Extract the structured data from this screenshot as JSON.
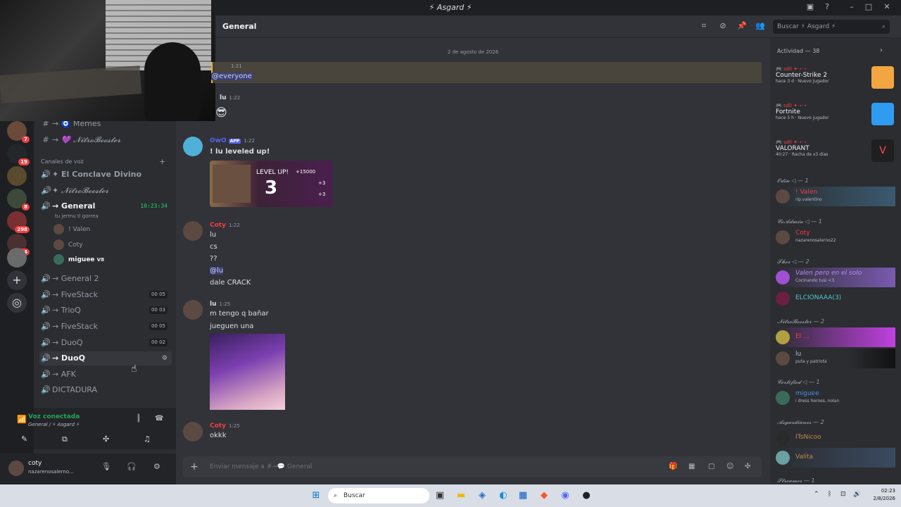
{
  "window": {
    "title": "⚡ Asgard ⚡"
  },
  "servers": [
    {
      "badge": "7"
    },
    {
      "badge": "19"
    },
    {
      "badge": ""
    },
    {
      "badge": "8"
    },
    {
      "badge": ""
    },
    {
      "badge": "298"
    },
    {
      "badge": "214"
    },
    {
      "badge": ""
    }
  ],
  "sidebar": {
    "text_channels": [
      {
        "label": "→ 🧿 Memes"
      },
      {
        "label": "→ 💜 𝓝𝓲𝓽𝓻𝓸𝓑𝓸𝓸𝓼𝓽𝓮𝓻"
      }
    ],
    "voice_category": "Canales de voz",
    "voice_channels": [
      {
        "label": "✦ El Conclave Divino",
        "count": ""
      },
      {
        "label": "✦ 𝓝𝓲𝓽𝓻𝓸𝓑𝓸𝓸𝓼𝓽𝓮𝓻",
        "count": ""
      },
      {
        "label": "→ General",
        "time": "10:23:34",
        "status": "tu jermu ti gorrea"
      },
      {
        "label": "→ General 2",
        "count": ""
      },
      {
        "label": "→ FiveStack",
        "count": "00 05"
      },
      {
        "label": "→ TrioQ",
        "count": "00 03"
      },
      {
        "label": "→ FiveStack",
        "count": "00 05"
      },
      {
        "label": "→ DuoQ",
        "count": "00 02"
      },
      {
        "label": "→ DuoQ",
        "count": ""
      },
      {
        "label": "→ AFK",
        "count": ""
      },
      {
        "label": "DICTADURA",
        "count": ""
      }
    ],
    "voice_members": [
      "! Valen",
      "Coty",
      "miguee"
    ],
    "member_tag": "V8",
    "voice_connected": "Voz conectada",
    "voice_location": "General / ⚡ Asgard ⚡",
    "user": {
      "name": "coty",
      "status": "nazarenosalerno..."
    }
  },
  "header": {
    "channel": "General",
    "search_placeholder": "Buscar ⚡ Asgard ⚡"
  },
  "chat": {
    "date": "2 de agosto de 2026",
    "m1": {
      "time": "1:21",
      "text": "@everyone"
    },
    "m2": {
      "name": "lu",
      "time": "1:22"
    },
    "m3": {
      "name": "OwO",
      "app": "APP",
      "time": "1:22",
      "text": "! lu leveled up!",
      "level_label": "LEVEL UP!",
      "level": "3",
      "xp": "+15000",
      "r1": "+3",
      "r2": "+3"
    },
    "m4": {
      "name": "Coty",
      "time": "1:22",
      "lines": [
        "lu",
        "cs",
        "??",
        "@lu",
        "dale CRACK"
      ]
    },
    "m5": {
      "name": "lu",
      "time": "1:25",
      "lines": [
        "m tengo q bañar",
        "jueguen una"
      ]
    },
    "m6": {
      "name": "Coty",
      "time": "1:25",
      "text": "okkk"
    },
    "composer_placeholder": "Enviar mensaje a #→💬 General"
  },
  "activity": {
    "title": "Actividad — 38",
    "items": [
      {
        "game": "Counter-Strike 2",
        "sub": "hace 3 d · Nuevo jugador",
        "color": "#f2a541"
      },
      {
        "game": "Fortnite",
        "sub": "hace 5 h · Nuevo jugador",
        "color": "#2f9cf2"
      },
      {
        "game": "VALORANT",
        "sub": "40:27 · Racha de x3 días",
        "color": "#ff4655"
      }
    ]
  },
  "roles": [
    {
      "title": "𝓞𝓭𝓲𝓷 ◁ — 1",
      "members": [
        {
          "name": "! Valen",
          "sub": "rip.valentino"
        }
      ]
    },
    {
      "title": "𝓒𝓸𝓐𝓭𝓶𝓲𝓷 ◁ — 1",
      "members": [
        {
          "name": "Coty",
          "sub": "nazarenosalerno22"
        }
      ]
    },
    {
      "title": "𝓣𝓱𝓸𝓻 ◁ — 2",
      "members": [
        {
          "name": "Valen pero en el solo",
          "sub": "Cocinando tusi <3"
        },
        {
          "name": "ELCIONAAA(3)",
          "sub": ""
        }
      ]
    },
    {
      "title": "𝓝𝓲𝓽𝓻𝓸𝓑𝓸𝓸𝓼𝓽𝓮𝓻 — 2",
      "members": [
        {
          "name": "El ...",
          "sub": ""
        },
        {
          "name": "lu",
          "sub": "puta y patriota"
        }
      ]
    },
    {
      "title": "𝓒𝓮𝓻𝓽𝓲𝓯𝓲𝓮𝓭 ◁ — 1",
      "members": [
        {
          "name": "miguee",
          "sub": "i dress heroes, nolan"
        }
      ]
    },
    {
      "title": "𝓐𝓼𝓰𝓪𝓻𝓭𝓲𝓪𝓷𝓸𝓼 — 2",
      "members": [
        {
          "name": "ITsNicoo",
          "sub": ""
        },
        {
          "name": "Valita",
          "sub": ""
        }
      ]
    },
    {
      "title": "𝓢𝓽𝓻𝓮𝓪𝓶𝓮𝓻 — 1",
      "members": []
    }
  ],
  "taskbar": {
    "search": "Buscar",
    "time": "02:23",
    "date": "2/8/2026"
  }
}
